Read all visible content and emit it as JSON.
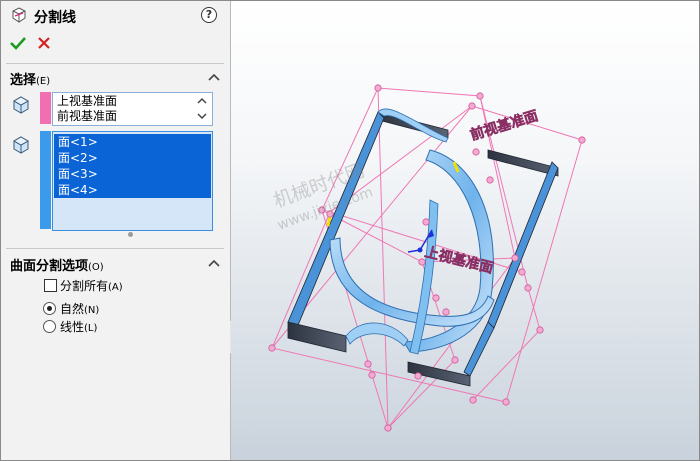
{
  "panel": {
    "title": "分割线",
    "help": "?",
    "selection": {
      "title": "选择",
      "shortcut": "(E)",
      "planes": [
        "上视基准面",
        "前视基准面"
      ],
      "faces": [
        "面<1>",
        "面<2>",
        "面<3>",
        "面<4>"
      ]
    },
    "options": {
      "title": "曲面分割选项",
      "shortcut": "(O)",
      "split_all": "分割所有",
      "split_all_key": "(A)",
      "split_all_checked": false,
      "natural": "自然",
      "natural_key": "(N)",
      "linear": "线性",
      "linear_key": "(L)",
      "selected": "natural"
    }
  },
  "viewport": {
    "plane_label_1": "前视基准面",
    "plane_label_2": "上视基准面",
    "watermark_1": "机械时代网",
    "watermark_2": "www.jixie.com"
  },
  "colors": {
    "plane": "#ef77b4",
    "selected": "#0a64d6",
    "model": "#4aa0ea",
    "bg": "#f2f2f2"
  }
}
